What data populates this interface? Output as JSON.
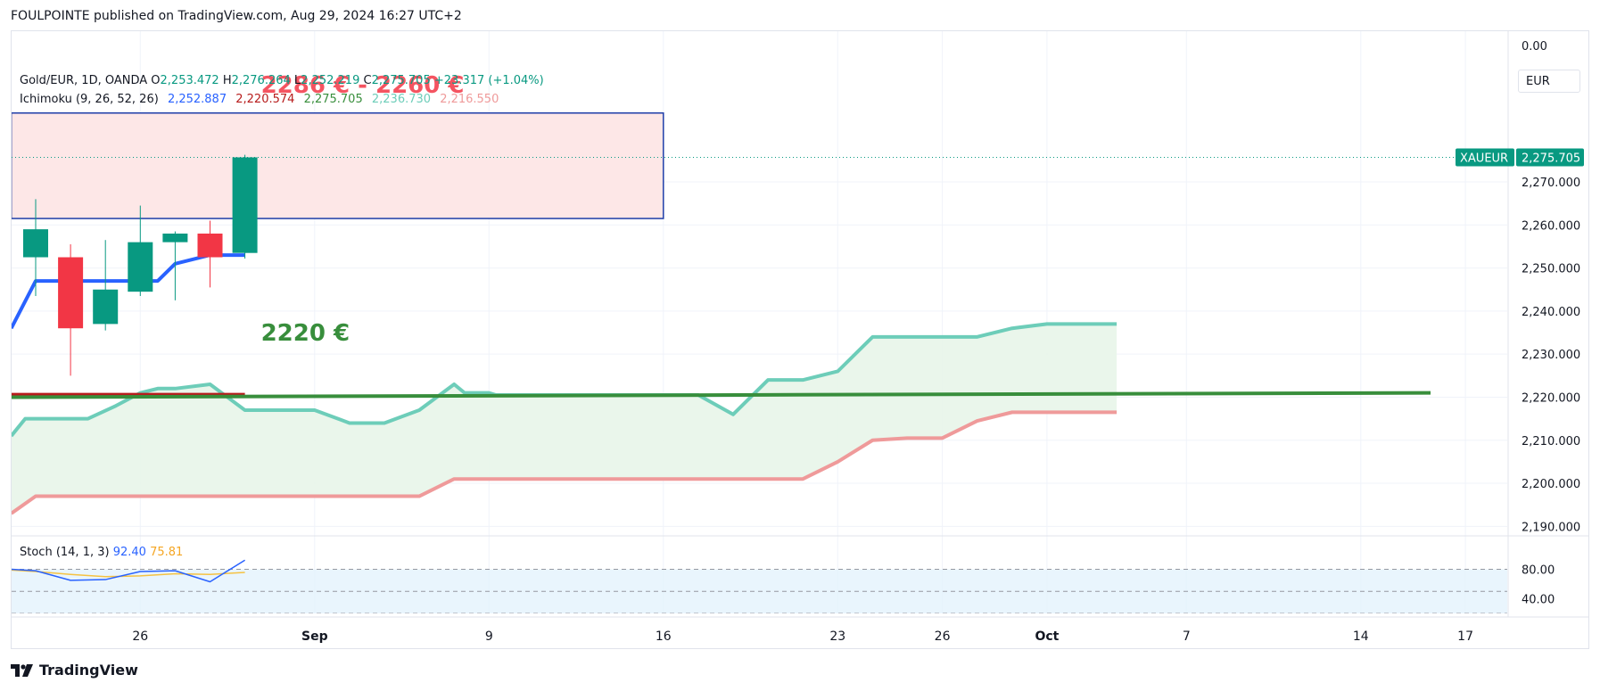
{
  "header": {
    "text": "FOULPOINTE published on TradingView.com, Aug 29, 2024 16:27 UTC+2"
  },
  "footer": {
    "brand": "TradingView"
  },
  "colors": {
    "up": "#089981",
    "down": "#f23645",
    "tenkan": "#2962ff",
    "kijun": "#b71c1c",
    "spanA": "#6dcdb9",
    "spanB": "#ef9a9a",
    "cloud": "#e8f5e9",
    "support": "#388e3c",
    "zone_fill": "#fde6e6",
    "zone_border": "#1e3ea8",
    "stoch_k": "#2962ff",
    "stoch_d": "#f5c242",
    "stoch_band": "#e3f2fd",
    "price_tag": "#089981"
  },
  "legend": {
    "symbol": "Gold/EUR, 1D, OANDA",
    "o_label": "O",
    "o_value": "2,253.472",
    "h_label": "H",
    "h_value": "2,276.264",
    "l_label": "L",
    "l_value": "2,252.219",
    "c_label": "C",
    "c_value": "2,275.705",
    "change": "+23.317 (+1.04%)",
    "ichimoku_label": "Ichimoku (9, 26, 52, 26)",
    "ichimoku_values": [
      "2,252.887",
      "2,220.574",
      "2,275.705",
      "2,236.730",
      "2,216.550"
    ]
  },
  "stoch_legend": {
    "label": "Stoch (14, 1, 3)",
    "k_value": "92.40",
    "d_value": "75.81"
  },
  "price_scale": {
    "currency": "EUR",
    "symbol_tag": "XAUEUR",
    "last_price": "2,275.705"
  },
  "annotations": {
    "resistance_label": "2286 € - 2260 €",
    "support_label": "2220 €"
  },
  "chart_data": [
    {
      "type": "candlestick",
      "title": "Gold/EUR, 1D, OANDA",
      "ylim": [
        2188,
        2305
      ],
      "y_ticks": [
        2190,
        2200,
        2210,
        2220,
        2230,
        2240,
        2250,
        2260,
        2270
      ],
      "y_tick_labels": [
        "2,190.000",
        "2,200.000",
        "2,210.000",
        "2,220.000",
        "2,230.000",
        "2,240.000",
        "2,250.000",
        "2,260.000",
        "2,270.000"
      ],
      "top_tick_label": "0.00",
      "x_ticks": [
        {
          "label": "26",
          "idx": 3
        },
        {
          "label": "Sep",
          "idx": 8
        },
        {
          "label": "9",
          "idx": 13
        },
        {
          "label": "16",
          "idx": 18
        },
        {
          "label": "23",
          "idx": 23
        },
        {
          "label": "26",
          "idx": 26
        },
        {
          "label": "Oct",
          "idx": 29
        },
        {
          "label": "7",
          "idx": 33
        },
        {
          "label": "14",
          "idx": 38
        },
        {
          "label": "17",
          "idx": 41
        }
      ],
      "candles": [
        {
          "idx": 0,
          "open": 2252.5,
          "high": 2266.0,
          "low": 2243.5,
          "close": 2259.0
        },
        {
          "idx": 1,
          "open": 2252.5,
          "high": 2255.5,
          "low": 2225.0,
          "close": 2236.0
        },
        {
          "idx": 2,
          "open": 2237.0,
          "high": 2256.5,
          "low": 2235.5,
          "close": 2245.0
        },
        {
          "idx": 3,
          "open": 2244.5,
          "high": 2264.5,
          "low": 2243.5,
          "close": 2256.0
        },
        {
          "idx": 4,
          "open": 2256.0,
          "high": 2258.5,
          "low": 2242.5,
          "close": 2258.0
        },
        {
          "idx": 5,
          "open": 2258.0,
          "high": 2261.0,
          "low": 2245.5,
          "close": 2252.5
        },
        {
          "idx": 6,
          "open": 2253.5,
          "high": 2276.3,
          "low": 2252.2,
          "close": 2275.7
        }
      ],
      "tenkan": {
        "x": [
          -0.7,
          0,
          2.5,
          3.5,
          4,
          5,
          6
        ],
        "y": [
          2236,
          2247,
          2247,
          2247,
          2251,
          2253,
          2253
        ]
      },
      "kijun": {
        "x": [
          -0.7,
          6
        ],
        "y": [
          2220.6,
          2220.6
        ]
      },
      "span_a": {
        "x": [
          -0.7,
          -0.3,
          0.5,
          1.5,
          2.3,
          3,
          3.5,
          4,
          5,
          6,
          7,
          8,
          9,
          10,
          11,
          12,
          12.3,
          13,
          13.2,
          14,
          15,
          16,
          17,
          18,
          19,
          20,
          21,
          21.3,
          22,
          23,
          24,
          25,
          26,
          27,
          28,
          29,
          30,
          31
        ],
        "y": [
          2211,
          2215,
          2215,
          2215,
          2218,
          2221,
          2222,
          2222,
          2223,
          2217,
          2217,
          2217,
          2214,
          2214,
          2217,
          2223,
          2221,
          2221,
          2220.5,
          2220.5,
          2220.5,
          2220.5,
          2220.5,
          2220.5,
          2220.5,
          2216,
          2224,
          2224,
          2224,
          2226,
          2234,
          2234,
          2234,
          2234,
          2236,
          2237,
          2237,
          2237
        ]
      },
      "span_b": {
        "x": [
          -0.7,
          0,
          5,
          6,
          11,
          12,
          13,
          14,
          15,
          18,
          22,
          23,
          24,
          25,
          26,
          27,
          28,
          29,
          30,
          31
        ],
        "y": [
          2193,
          2197,
          2197,
          2197,
          2197,
          2201,
          2201,
          2201,
          2201,
          2201,
          2201,
          2205,
          2210,
          2210.5,
          2210.5,
          2214.5,
          2216.5,
          2216.5,
          2216.5,
          2216.5
        ]
      },
      "support_line": {
        "x": [
          -0.7,
          40
        ],
        "y": [
          2220.0,
          2221.0
        ]
      },
      "resistance_zone": {
        "x": [
          -0.7,
          18
        ],
        "y": [
          2261.5,
          2286.0
        ]
      },
      "last_price": 2275.705
    },
    {
      "type": "line",
      "title": "Stoch (14, 1, 3)",
      "ylim": [
        20,
        100
      ],
      "y_ticks": [
        40,
        80
      ],
      "y_tick_labels": [
        "40.00",
        "80.00"
      ],
      "band": [
        20,
        80
      ],
      "midline": 50,
      "series": [
        {
          "name": "%K",
          "x": [
            -0.7,
            0,
            1,
            2,
            3,
            4,
            5,
            6
          ],
          "y": [
            80,
            78,
            65,
            66,
            77,
            78,
            63,
            92.4
          ]
        },
        {
          "name": "%D",
          "x": [
            -0.7,
            0,
            1,
            2,
            3,
            4,
            5,
            6
          ],
          "y": [
            79,
            77,
            73,
            70,
            71,
            74,
            73,
            75.8
          ]
        }
      ]
    }
  ]
}
